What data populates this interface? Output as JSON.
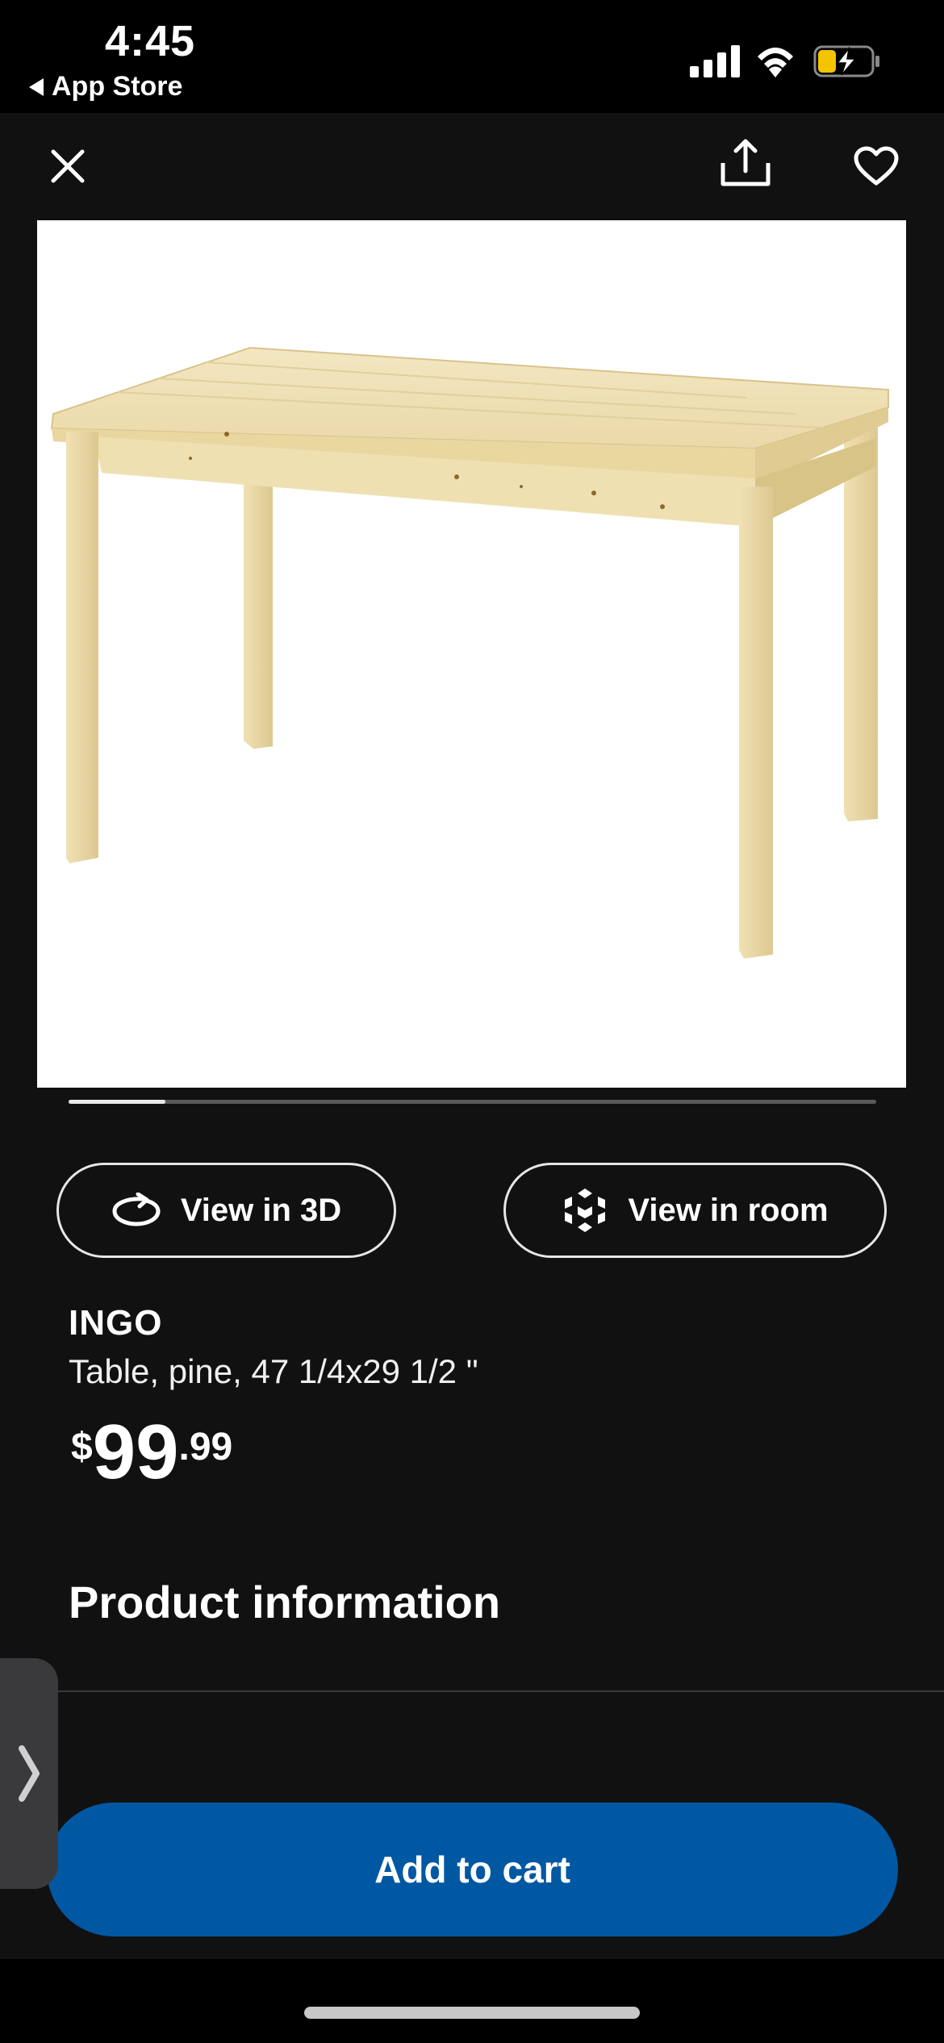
{
  "status_bar": {
    "time": "4:45",
    "back_app": "App Store"
  },
  "nav": {
    "close_icon": "close-icon",
    "share_icon": "share-icon",
    "favorite_icon": "heart-icon"
  },
  "gallery": {
    "image_subject": "pine dining table",
    "progress": 0.12
  },
  "actions": {
    "view_3d": "View in 3D",
    "view_room": "View in room"
  },
  "product": {
    "name": "INGO",
    "description": "Table, pine, 47 1/4x29 1/2 \"",
    "price_currency": "$",
    "price_whole": "99",
    "price_cents": ".99"
  },
  "sections": {
    "product_information": "Product information"
  },
  "cart": {
    "add_label": "Add to cart"
  },
  "colors": {
    "background": "#111111",
    "accent": "#0058a3"
  }
}
